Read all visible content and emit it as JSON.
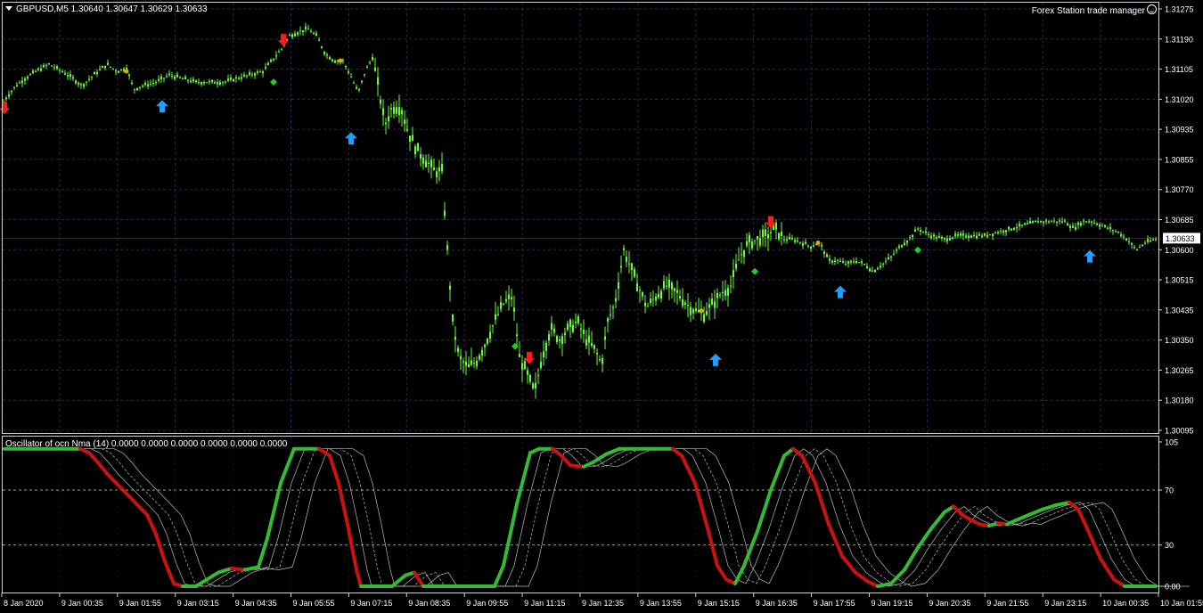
{
  "symbol_header": "GBPUSD,M5  1.30640 1.30647 1.30629 1.30633",
  "trade_manager": "Forex Station trade manager",
  "indicator_header": "Oscillator of ocn Nma (14) 0.0000 0.0000 0.0000 0.0000 0.0000 0.0000",
  "colors": {
    "background": "#000000",
    "grid": "#1c2c5c",
    "candle": "#66ff33",
    "up_arrow": "#1e9fff",
    "down_arrow": "#ff1a1a",
    "osc_up": "#33bb33",
    "osc_down": "#cc1111",
    "band": "#bbbbbb",
    "price_line": "#1c2c5c"
  },
  "icons": {
    "up_arrow": "arrow-up-icon",
    "down_arrow": "arrow-down-icon",
    "diamond": "diamond-icon",
    "smiley": "smiley-icon"
  },
  "price_axis": {
    "labels": [
      "1.31275",
      "1.31190",
      "1.31105",
      "1.31020",
      "1.30935",
      "1.30855",
      "1.30770",
      "1.30685",
      "1.30600",
      "1.30515",
      "1.30435",
      "1.30350",
      "1.30265",
      "1.30180",
      "1.30095"
    ],
    "current_price": "1.30633",
    "range": [
      1.30095,
      1.31275
    ]
  },
  "osc_axis": {
    "labels": [
      "105",
      "70",
      "30",
      "0.00"
    ],
    "range": [
      0,
      105
    ],
    "levels": [
      70,
      30
    ]
  },
  "time_axis": {
    "labels": [
      "8 Jan 2020",
      "9 Jan 00:35",
      "9 Jan 01:55",
      "9 Jan 03:15",
      "9 Jan 04:35",
      "9 Jan 05:55",
      "9 Jan 07:15",
      "9 Jan 08:35",
      "9 Jan 09:55",
      "9 Jan 11:15",
      "9 Jan 12:35",
      "9 Jan 13:55",
      "9 Jan 15:15",
      "9 Jan 16:35",
      "9 Jan 17:55",
      "9 Jan 19:15",
      "9 Jan 20:35",
      "9 Jan 21:55",
      "9 Jan 23:15",
      "10 Jan 00:35",
      "10 Jan 01:55"
    ]
  },
  "chart_data": [
    {
      "type": "candlestick",
      "title": "GBPUSD,M5",
      "ylim": [
        1.30095,
        1.31275
      ],
      "price_path": [
        [
          0,
          1.31
        ],
        [
          8,
          1.3103
        ],
        [
          18,
          1.3106
        ],
        [
          28,
          1.3108
        ],
        [
          40,
          1.311
        ],
        [
          55,
          1.3112
        ],
        [
          70,
          1.311
        ],
        [
          82,
          1.3108
        ],
        [
          92,
          1.3106
        ],
        [
          105,
          1.3109
        ],
        [
          120,
          1.3112
        ],
        [
          132,
          1.311
        ],
        [
          142,
          1.3111
        ],
        [
          150,
          1.3105
        ],
        [
          160,
          1.3106
        ],
        [
          175,
          1.3107
        ],
        [
          190,
          1.3109
        ],
        [
          205,
          1.3108
        ],
        [
          220,
          1.3107
        ],
        [
          235,
          1.3107
        ],
        [
          250,
          1.3107
        ],
        [
          265,
          1.3108
        ],
        [
          280,
          1.3109
        ],
        [
          295,
          1.311
        ],
        [
          305,
          1.3113
        ],
        [
          315,
          1.3116
        ],
        [
          325,
          1.312
        ],
        [
          335,
          1.3121
        ],
        [
          345,
          1.3122
        ],
        [
          355,
          1.312
        ],
        [
          365,
          1.3115
        ],
        [
          375,
          1.3113
        ],
        [
          385,
          1.3113
        ],
        [
          395,
          1.3108
        ],
        [
          402,
          1.3104
        ],
        [
          410,
          1.311
        ],
        [
          418,
          1.3114
        ],
        [
          425,
          1.3105
        ],
        [
          432,
          1.3095
        ],
        [
          440,
          1.31
        ],
        [
          450,
          1.31
        ],
        [
          458,
          1.3093
        ],
        [
          468,
          1.3088
        ],
        [
          478,
          1.3085
        ],
        [
          488,
          1.3082
        ],
        [
          496,
          1.3082
        ],
        [
          502,
          1.306
        ],
        [
          508,
          1.304
        ],
        [
          515,
          1.303
        ],
        [
          525,
          1.3027
        ],
        [
          535,
          1.3029
        ],
        [
          545,
          1.3034
        ],
        [
          555,
          1.304
        ],
        [
          565,
          1.3045
        ],
        [
          575,
          1.3047
        ],
        [
          583,
          1.303
        ],
        [
          592,
          1.3025
        ],
        [
          600,
          1.302
        ],
        [
          608,
          1.303
        ],
        [
          618,
          1.3038
        ],
        [
          628,
          1.3035
        ],
        [
          638,
          1.3038
        ],
        [
          648,
          1.304
        ],
        [
          658,
          1.3035
        ],
        [
          668,
          1.3032
        ],
        [
          675,
          1.3028
        ],
        [
          682,
          1.304
        ],
        [
          690,
          1.3045
        ],
        [
          700,
          1.306
        ],
        [
          708,
          1.3055
        ],
        [
          716,
          1.305
        ],
        [
          726,
          1.3044
        ],
        [
          736,
          1.3047
        ],
        [
          748,
          1.305
        ],
        [
          760,
          1.3048
        ],
        [
          770,
          1.3045
        ],
        [
          780,
          1.3043
        ],
        [
          790,
          1.3042
        ],
        [
          800,
          1.3045
        ],
        [
          810,
          1.3048
        ],
        [
          820,
          1.305
        ],
        [
          830,
          1.3058
        ],
        [
          840,
          1.3062
        ],
        [
          850,
          1.3063
        ],
        [
          860,
          1.3064
        ],
        [
          870,
          1.3066
        ],
        [
          880,
          1.3063
        ],
        [
          890,
          1.3063
        ],
        [
          900,
          1.3062
        ],
        [
          910,
          1.3061
        ],
        [
          920,
          1.3062
        ],
        [
          930,
          1.3057
        ],
        [
          940,
          1.3057
        ],
        [
          950,
          1.3056
        ],
        [
          960,
          1.3057
        ],
        [
          970,
          1.3056
        ],
        [
          980,
          1.3054
        ],
        [
          990,
          1.3056
        ],
        [
          1000,
          1.3058
        ],
        [
          1010,
          1.3061
        ],
        [
          1020,
          1.3063
        ],
        [
          1030,
          1.3066
        ],
        [
          1045,
          1.3064
        ],
        [
          1060,
          1.3063
        ],
        [
          1075,
          1.3064
        ],
        [
          1090,
          1.3064
        ],
        [
          1105,
          1.3064
        ],
        [
          1120,
          1.3065
        ],
        [
          1135,
          1.3066
        ],
        [
          1150,
          1.3067
        ],
        [
          1165,
          1.3068
        ],
        [
          1180,
          1.3068
        ],
        [
          1195,
          1.3068
        ],
        [
          1205,
          1.3066
        ],
        [
          1215,
          1.3068
        ],
        [
          1225,
          1.3068
        ],
        [
          1235,
          1.3067
        ],
        [
          1245,
          1.3066
        ],
        [
          1255,
          1.3065
        ],
        [
          1265,
          1.3063
        ],
        [
          1275,
          1.306
        ],
        [
          1285,
          1.3062
        ],
        [
          1297,
          1.3063
        ]
      ],
      "up_arrows": [
        [
          182,
          1.3102
        ],
        [
          394,
          1.3093
        ],
        [
          803,
          1.3031
        ],
        [
          943,
          1.305
        ],
        [
          1223,
          1.306
        ]
      ],
      "down_arrows": [
        [
          5,
          1.3098
        ],
        [
          318,
          1.3117
        ],
        [
          594,
          1.3028
        ],
        [
          865,
          1.3066
        ]
      ],
      "diamonds": [
        [
          307,
          1.3107
        ],
        [
          578,
          1.3033
        ],
        [
          847,
          1.3054
        ],
        [
          1030,
          1.306
        ]
      ],
      "dots": [
        [
          142,
          1.311
        ],
        [
          382,
          1.3113
        ],
        [
          787,
          1.3043
        ],
        [
          918,
          1.3062
        ]
      ]
    },
    {
      "type": "line",
      "title": "Oscillator of ocn Nma (14)",
      "ylim": [
        0,
        105
      ],
      "levels": [
        70,
        30
      ],
      "main": [
        [
          5,
          100
        ],
        [
          40,
          100
        ],
        [
          90,
          100
        ],
        [
          100,
          97
        ],
        [
          110,
          90
        ],
        [
          120,
          82
        ],
        [
          135,
          72
        ],
        [
          150,
          62
        ],
        [
          165,
          52
        ],
        [
          175,
          38
        ],
        [
          185,
          18
        ],
        [
          195,
          2
        ],
        [
          205,
          0
        ],
        [
          220,
          0
        ],
        [
          230,
          4
        ],
        [
          245,
          10
        ],
        [
          260,
          13
        ],
        [
          275,
          12
        ],
        [
          290,
          14
        ],
        [
          300,
          35
        ],
        [
          315,
          75
        ],
        [
          330,
          100
        ],
        [
          358,
          100
        ],
        [
          370,
          95
        ],
        [
          380,
          75
        ],
        [
          390,
          45
        ],
        [
          400,
          12
        ],
        [
          405,
          0
        ],
        [
          440,
          0
        ],
        [
          455,
          8
        ],
        [
          465,
          10
        ],
        [
          475,
          0
        ],
        [
          555,
          0
        ],
        [
          565,
          15
        ],
        [
          580,
          60
        ],
        [
          595,
          97
        ],
        [
          605,
          100
        ],
        [
          620,
          100
        ],
        [
          630,
          95
        ],
        [
          640,
          88
        ],
        [
          655,
          87
        ],
        [
          665,
          90
        ],
        [
          680,
          96
        ],
        [
          695,
          100
        ],
        [
          755,
          100
        ],
        [
          765,
          95
        ],
        [
          780,
          75
        ],
        [
          795,
          40
        ],
        [
          805,
          15
        ],
        [
          815,
          5
        ],
        [
          825,
          2
        ],
        [
          835,
          15
        ],
        [
          850,
          40
        ],
        [
          865,
          70
        ],
        [
          880,
          95
        ],
        [
          890,
          100
        ],
        [
          900,
          95
        ],
        [
          915,
          75
        ],
        [
          930,
          45
        ],
        [
          945,
          22
        ],
        [
          960,
          10
        ],
        [
          975,
          3
        ],
        [
          985,
          0
        ],
        [
          1000,
          2
        ],
        [
          1015,
          12
        ],
        [
          1030,
          28
        ],
        [
          1045,
          42
        ],
        [
          1060,
          54
        ],
        [
          1070,
          58
        ],
        [
          1080,
          52
        ],
        [
          1090,
          48
        ],
        [
          1100,
          45
        ],
        [
          1110,
          44
        ],
        [
          1120,
          46
        ],
        [
          1130,
          45
        ],
        [
          1140,
          48
        ],
        [
          1155,
          52
        ],
        [
          1170,
          56
        ],
        [
          1185,
          59
        ],
        [
          1200,
          61
        ],
        [
          1210,
          56
        ],
        [
          1220,
          42
        ],
        [
          1235,
          20
        ],
        [
          1250,
          5
        ],
        [
          1262,
          0
        ],
        [
          1297,
          0
        ]
      ]
    }
  ]
}
